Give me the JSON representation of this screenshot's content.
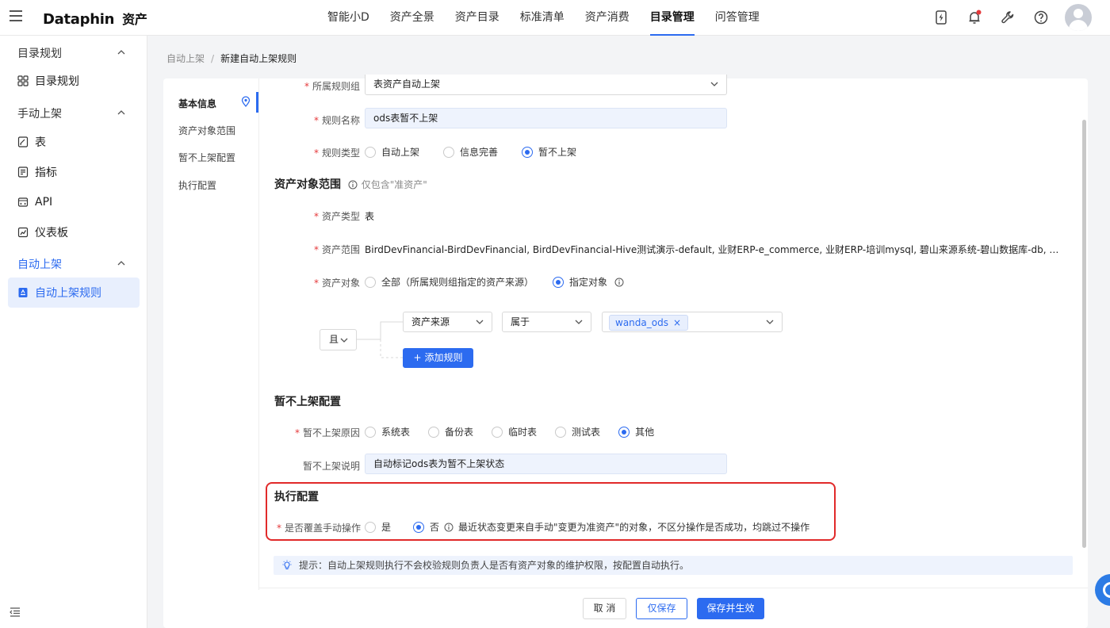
{
  "app": {
    "logo": "Dataphin",
    "module": "资产"
  },
  "nav": {
    "items": [
      "智能小D",
      "资产全景",
      "资产目录",
      "标准清单",
      "资产消费",
      "目录管理",
      "问答管理"
    ],
    "active_index": 5
  },
  "colors": {
    "accent": "#2c6bf0",
    "required": "#e5393b",
    "highlight_border": "#e12a2a",
    "notification_dot": "#e5393b"
  },
  "sidebar": {
    "groups": [
      {
        "label": "目录规划",
        "items": [
          {
            "label": "目录规划",
            "icon": "grid-icon"
          }
        ]
      },
      {
        "label": "手动上架",
        "items": [
          {
            "label": "表",
            "icon": "table-doc-icon"
          },
          {
            "label": "指标",
            "icon": "metric-doc-icon"
          },
          {
            "label": "API",
            "icon": "api-icon"
          },
          {
            "label": "仪表板",
            "icon": "dashboard-icon"
          }
        ]
      },
      {
        "label": "自动上架",
        "items": [
          {
            "label": "自动上架规则",
            "icon": "rule-doc-icon",
            "active": true
          }
        ]
      }
    ]
  },
  "breadcrumb": {
    "parent": "自动上架",
    "separator": "/",
    "current": "新建自动上架规则"
  },
  "anchor": {
    "items": [
      "基本信息",
      "资产对象范围",
      "暂不上架配置",
      "执行配置"
    ],
    "active_index": 0
  },
  "basic": {
    "rule_group": {
      "label": "所属规则组",
      "value": "表资产自动上架"
    },
    "rule_name": {
      "label": "规则名称",
      "value": "ods表暂不上架"
    },
    "rule_type": {
      "label": "规则类型",
      "options": [
        "自动上架",
        "信息完善",
        "暂不上架"
      ],
      "selected": 2
    }
  },
  "scope": {
    "title": "资产对象范围",
    "hint": "仅包含\"准资产\"",
    "asset_type": {
      "label": "资产类型",
      "value": "表"
    },
    "asset_range": {
      "label": "资产范围",
      "value": "BirdDevFinancial-BirdDevFinancial, BirdDevFinancial-Hive测试演示-default, 业财ERP-e_commerce, 业财ERP-培训mysql, 碧山来源系统-碧山数据库-db, 双流自己的数据库-..."
    },
    "asset_object": {
      "label": "资产对象",
      "options": [
        "全部（所属规则组指定的资产来源）",
        "指定对象"
      ],
      "selected": 1
    },
    "logic": "且",
    "condition": {
      "field": "资产来源",
      "operator": "属于",
      "tag": "wanda_ods",
      "tag_close": "×"
    },
    "add_rule_label": "添加规则",
    "add_rule_icon": "+"
  },
  "hold": {
    "title": "暂不上架配置",
    "reason": {
      "label": "暂不上架原因",
      "options": [
        "系统表",
        "备份表",
        "临时表",
        "测试表",
        "其他"
      ],
      "selected": 4
    },
    "desc": {
      "label": "暂不上架说明",
      "value": "自动标记ods表为暂不上架状态"
    }
  },
  "exec": {
    "title": "执行配置",
    "override": {
      "label": "是否覆盖手动操作",
      "options": [
        "是",
        "否"
      ],
      "selected": 1
    },
    "override_note": "最近状态变更来自手动\"变更为准资产\"的对象，不区分操作是否成功，均跳过不操作"
  },
  "tip": "提示：自动上架规则执行不会校验规则负责人是否有资产对象的维护权限，按配置自动执行。",
  "footer": {
    "cancel": "取 消",
    "save": "仅保存",
    "save_apply": "保存并生效"
  }
}
